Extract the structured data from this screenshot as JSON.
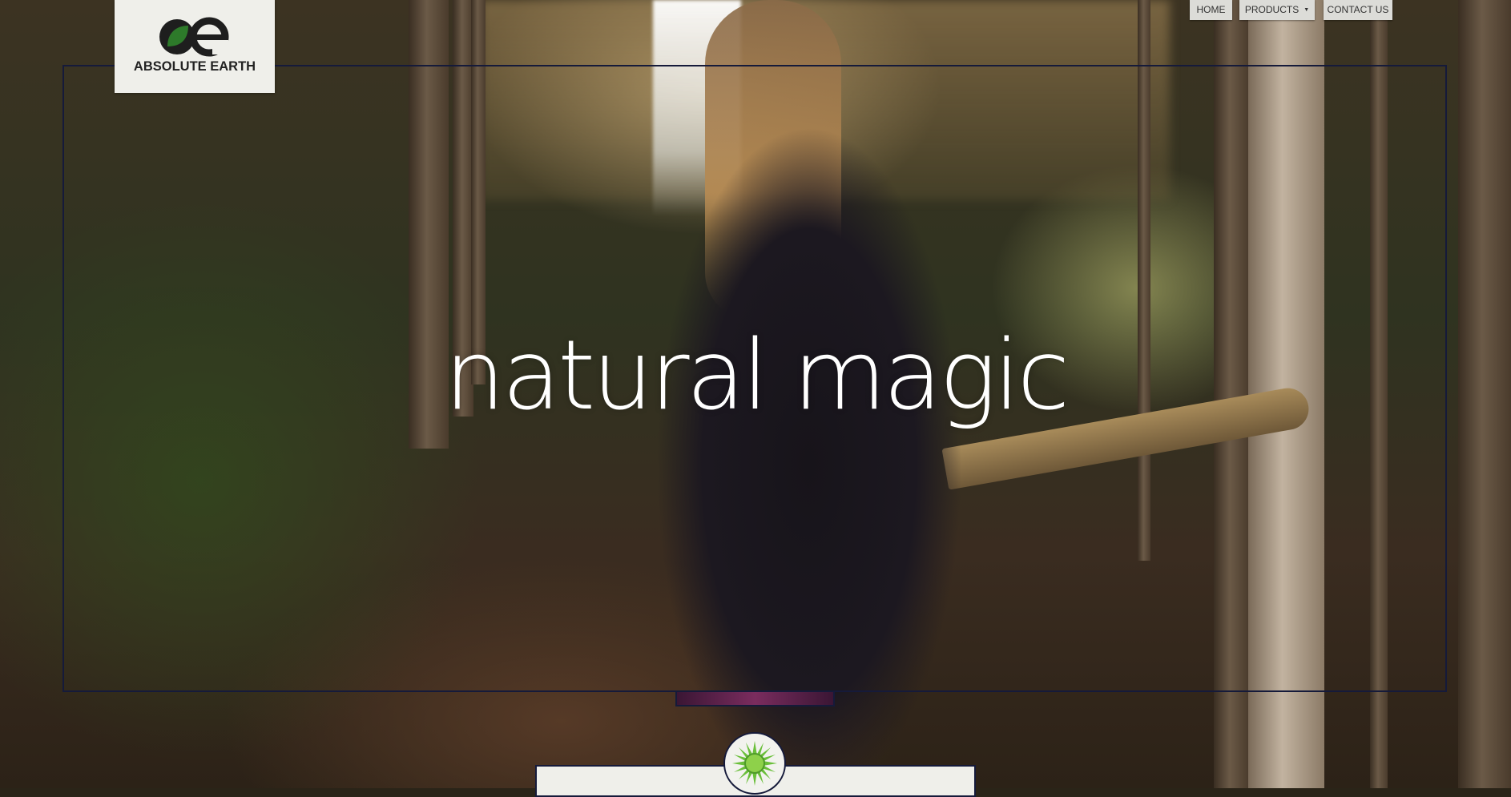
{
  "brand": {
    "logo_text": "ABSOLUTE EARTH",
    "logo_mark": "ae-leaf-logo",
    "accent": "#1e1e1e",
    "leaf_green": "#2d7a2a"
  },
  "nav": {
    "items": [
      {
        "label": "HOME"
      },
      {
        "label": "PRODUCTS",
        "has_dropdown": true
      },
      {
        "label": "CONTACT US"
      }
    ]
  },
  "hero": {
    "headline": "natural magic",
    "background": "forest-trail-waterfall-photo"
  },
  "badge": {
    "icon": "green-sunburst-icon",
    "color": "#6abf3a"
  }
}
